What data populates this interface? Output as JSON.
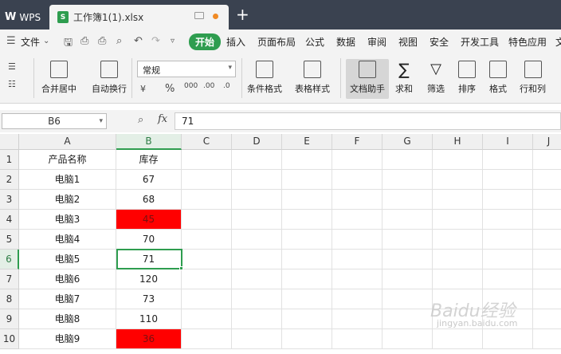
{
  "window": {
    "app_tab": "WPS",
    "doc_tab": "工作簿1(1).xlsx",
    "add_tab": "+"
  },
  "menu": {
    "file": "文件",
    "tabs": [
      "开始",
      "插入",
      "页面布局",
      "公式",
      "数据",
      "审阅",
      "视图",
      "安全",
      "开发工具",
      "特色应用",
      "文"
    ]
  },
  "ribbon": {
    "merge_center": "合并居中",
    "wrap_text": "自动换行",
    "number_format": "常规",
    "percent": "%",
    "thousands": "000",
    "inc_decimal": ".00",
    "dec_decimal": ".0",
    "cond_format": "条件格式",
    "table_style": "表格样式",
    "doc_helper": "文档助手",
    "sum": "求和",
    "filter": "筛选",
    "sort": "排序",
    "format": "格式",
    "row_col": "行和列"
  },
  "formula_bar": {
    "name_box": "B6",
    "fx": "fx",
    "value": "71"
  },
  "grid": {
    "columns": [
      "A",
      "B",
      "C",
      "D",
      "E",
      "F",
      "G",
      "H",
      "I",
      "J"
    ],
    "rows": [
      "1",
      "2",
      "3",
      "4",
      "5",
      "6",
      "7",
      "8",
      "9",
      "10"
    ],
    "data": [
      {
        "a": "产品名称",
        "b": "库存",
        "red": false
      },
      {
        "a": "电脑1",
        "b": "67",
        "red": false
      },
      {
        "a": "电脑2",
        "b": "68",
        "red": false
      },
      {
        "a": "电脑3",
        "b": "45",
        "red": true
      },
      {
        "a": "电脑4",
        "b": "70",
        "red": false
      },
      {
        "a": "电脑5",
        "b": "71",
        "red": false
      },
      {
        "a": "电脑6",
        "b": "120",
        "red": false
      },
      {
        "a": "电脑7",
        "b": "73",
        "red": false
      },
      {
        "a": "电脑8",
        "b": "110",
        "red": false
      },
      {
        "a": "电脑9",
        "b": "36",
        "red": true
      }
    ]
  },
  "colors": {
    "accent": "#2e9d4f",
    "highlight": "#ff0000",
    "titlebar": "#3a4250"
  },
  "watermark": {
    "brand": "Baidu经验",
    "url": "jingyan.baidu.com"
  }
}
